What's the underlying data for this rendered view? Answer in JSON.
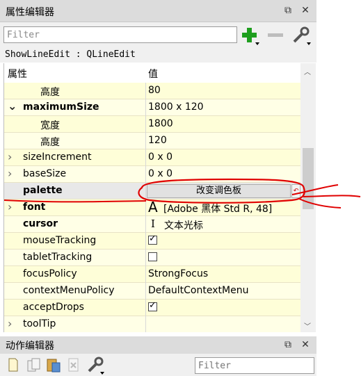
{
  "property_editor": {
    "title": "属性编辑器",
    "filter_placeholder": "Filter",
    "object_info": "ShowLineEdit : QLineEdit",
    "col_property": "属性",
    "col_value": "值"
  },
  "rows": [
    {
      "name": "高度",
      "value": "80",
      "indent": 2,
      "bold": false,
      "chevron": "",
      "bg": "#fefed8"
    },
    {
      "name": "maximumSize",
      "value": "1800 x 120",
      "indent": 1,
      "bold": true,
      "chevron": "down",
      "bg": "#ffffe6"
    },
    {
      "name": "宽度",
      "value": "1800",
      "indent": 2,
      "bold": false,
      "chevron": "",
      "bg": "#fefed8"
    },
    {
      "name": "高度",
      "value": "120",
      "indent": 2,
      "bold": false,
      "chevron": "",
      "bg": "#ffffe6"
    },
    {
      "name": "sizeIncrement",
      "value": "0 x 0",
      "indent": 1,
      "bold": false,
      "chevron": "right",
      "bg": "#fefed8"
    },
    {
      "name": "baseSize",
      "value": "0 x 0",
      "indent": 1,
      "bold": false,
      "chevron": "right",
      "bg": "#ffffe6"
    },
    {
      "name": "palette",
      "value": "改变调色板",
      "indent": 1,
      "bold": true,
      "chevron": "",
      "bg": "#e8e8e8",
      "button": true
    },
    {
      "name": "font",
      "value": "[Adobe 黑体 Std R, 48]",
      "indent": 1,
      "bold": true,
      "chevron": "right",
      "bg": "#fefed8",
      "icon": "A"
    },
    {
      "name": "cursor",
      "value": "文本光标",
      "indent": 1,
      "bold": true,
      "chevron": "",
      "bg": "#ffffe6",
      "icon": "I"
    },
    {
      "name": "mouseTracking",
      "value": "",
      "indent": 1,
      "bold": false,
      "chevron": "",
      "bg": "#fefed8",
      "checkbox": true,
      "checked": true
    },
    {
      "name": "tabletTracking",
      "value": "",
      "indent": 1,
      "bold": false,
      "chevron": "",
      "bg": "#ffffe6",
      "checkbox": true,
      "checked": false
    },
    {
      "name": "focusPolicy",
      "value": "StrongFocus",
      "indent": 1,
      "bold": false,
      "chevron": "",
      "bg": "#fefed8"
    },
    {
      "name": "contextMenuPolicy",
      "value": "DefaultContextMenu",
      "indent": 1,
      "bold": false,
      "chevron": "",
      "bg": "#ffffe6"
    },
    {
      "name": "acceptDrops",
      "value": "",
      "indent": 1,
      "bold": false,
      "chevron": "",
      "bg": "#fefed8",
      "checkbox": true,
      "checked": true
    },
    {
      "name": "toolTip",
      "value": "",
      "indent": 1,
      "bold": false,
      "chevron": "right",
      "bg": "#ffffe6"
    }
  ],
  "action_editor": {
    "title": "动作编辑器",
    "filter_placeholder": "Filter"
  },
  "colors": {
    "accent_green": "#1e9e1e",
    "annotation_red": "#e00000"
  }
}
